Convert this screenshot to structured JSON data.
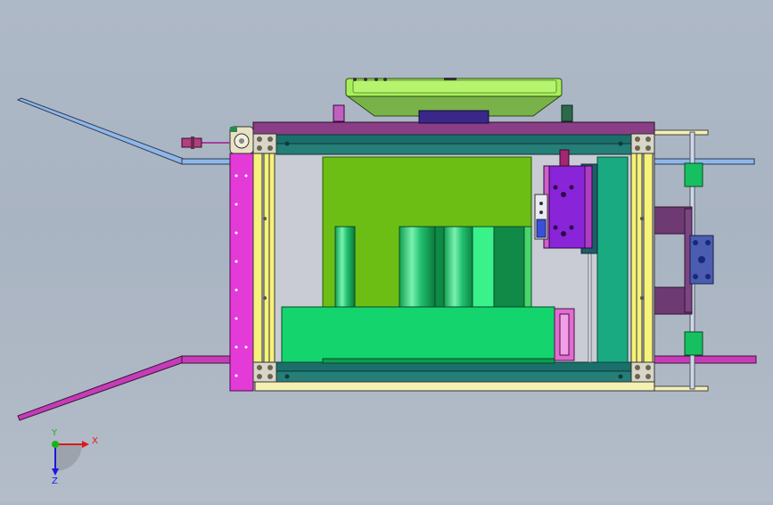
{
  "viewport": {
    "background_top": "#aeb9c8",
    "background_bottom": "#b3bcc8"
  },
  "axis_triad": {
    "x_label": "X",
    "y_label": "Y",
    "z_label": "Z",
    "x_color": "#e01818",
    "y_color": "#18b418",
    "z_color": "#1818e0"
  },
  "colors": {
    "frame_yellow": "#f6f27a",
    "frame_magenta": "#e43ad8",
    "plate_purple": "#8a3e86",
    "lime_block": "#6cbe14",
    "green_block": "#14d46e",
    "teal_slide": "#1aaa82",
    "rail_blue": "#8fb6e6",
    "violet_block": "#8a24d8",
    "dark_teal": "#1b6a6a",
    "top_pad": "#a8ee5a"
  }
}
